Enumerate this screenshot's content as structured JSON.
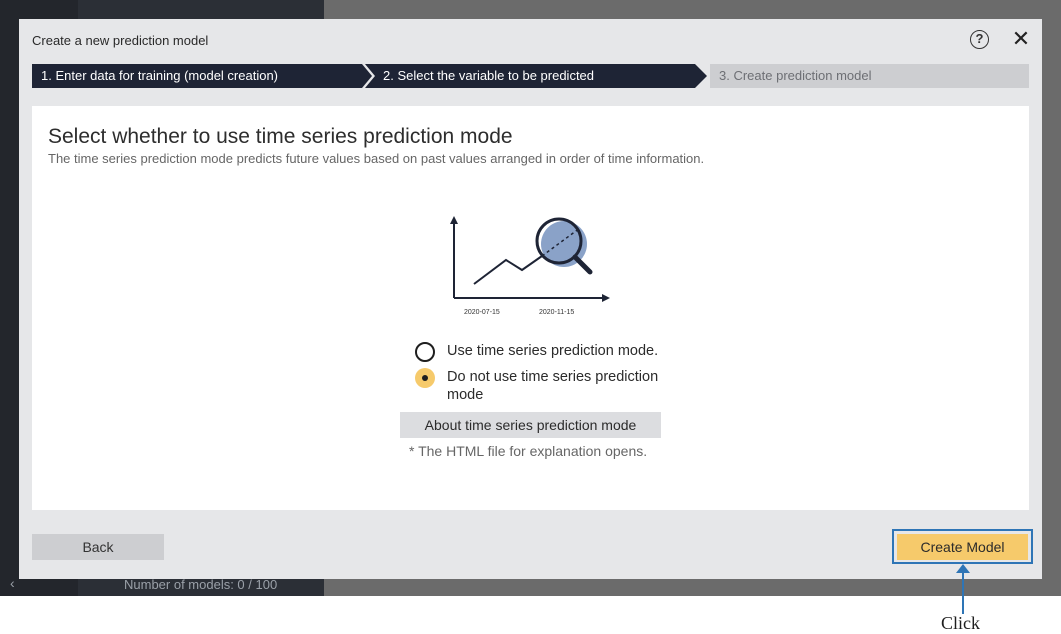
{
  "background": {
    "model_count": "Number of models: 0 / 100"
  },
  "dialog": {
    "title": "Create a new prediction model",
    "help_symbol": "?",
    "close_symbol": "✕"
  },
  "steps": [
    {
      "label": "1. Enter data for training (model creation)",
      "state": "completed"
    },
    {
      "label": "2. Select the variable to be predicted",
      "state": "completed"
    },
    {
      "label": "3. Create prediction model",
      "state": "current"
    }
  ],
  "content": {
    "heading": "Select whether to use time series prediction mode",
    "description": "The time series prediction mode predicts future values based on past values arranged in order of time information.",
    "illustration": {
      "date_left": "2020-07-15",
      "date_right": "2020-11-15",
      "accent_color": "#8aa2c8"
    },
    "options": [
      {
        "label": "Use time series prediction mode.",
        "selected": false
      },
      {
        "label": "Do not use time series prediction mode",
        "selected": true
      }
    ],
    "about_button": "About time series prediction mode",
    "note": "* The HTML file for explanation opens."
  },
  "footer": {
    "back_label": "Back",
    "create_label": "Create Model"
  },
  "annotation": {
    "callout_text": "Click",
    "highlight_color": "#2e75b6"
  },
  "colors": {
    "step_active": "#1e2435",
    "step_inactive": "#cdced1",
    "primary_button": "#f6ca6b",
    "dialog_bg": "#e6e7e9"
  }
}
